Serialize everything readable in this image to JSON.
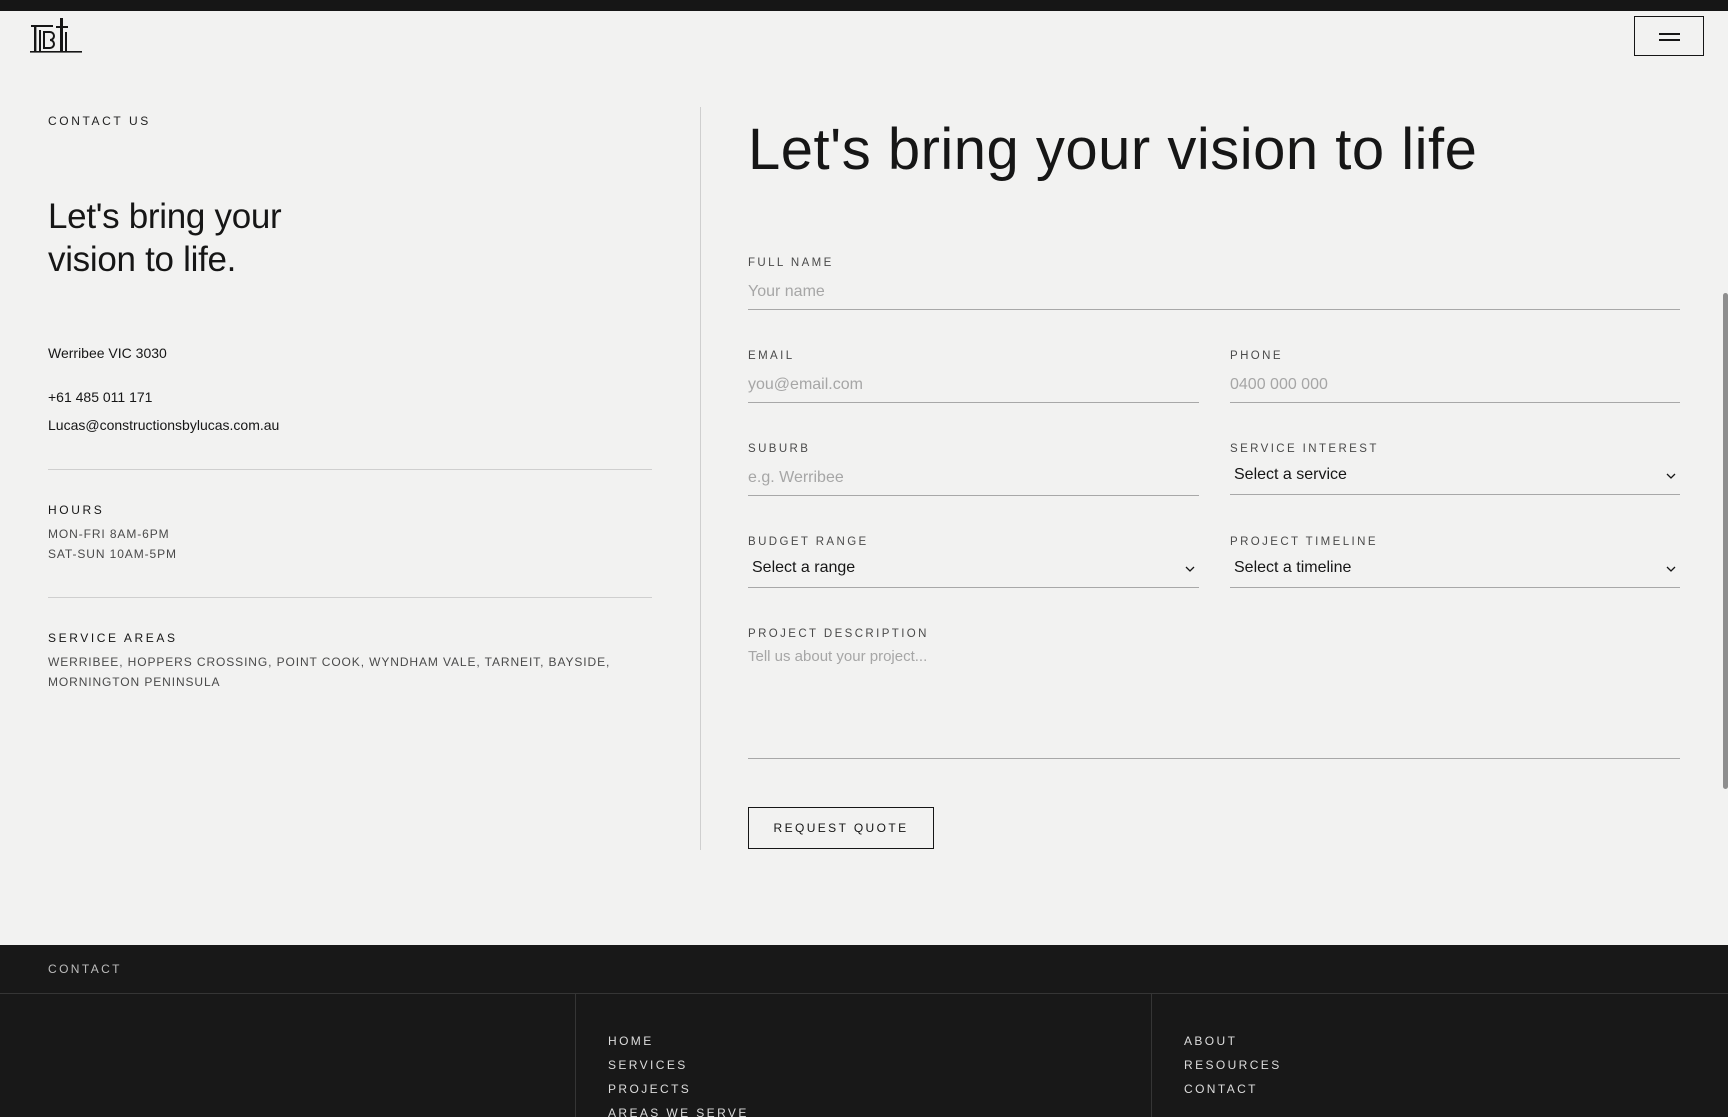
{
  "header": {
    "logo_alt": "TBL",
    "menu_icon": "hamburger-icon"
  },
  "contact": {
    "eyebrow": "CONTACT US",
    "heading": "Let's bring your vision to life.",
    "address": "Werribee VIC 3030",
    "phone": "+61 485 011 171",
    "email": "Lucas@constructionsbylucas.com.au",
    "hours_title": "HOURS",
    "hours": [
      "MON-FRI 8AM-6PM",
      "SAT-SUN 10AM-5PM"
    ],
    "areas_title": "SERVICE AREAS",
    "areas": "WERRIBEE, HOPPERS CROSSING, POINT COOK, WYNDHAM VALE, TARNEIT, BAYSIDE, MORNINGTON PENINSULA"
  },
  "form": {
    "heading": "Let's bring your vision to life",
    "full_name": {
      "label": "FULL NAME",
      "placeholder": "Your name"
    },
    "email": {
      "label": "EMAIL",
      "placeholder": "you@email.com"
    },
    "phone": {
      "label": "PHONE",
      "placeholder": "0400 000 000"
    },
    "suburb": {
      "label": "SUBURB",
      "placeholder": "e.g. Werribee"
    },
    "service": {
      "label": "SERVICE INTEREST",
      "value": "Select a service"
    },
    "budget": {
      "label": "BUDGET RANGE",
      "value": "Select a range"
    },
    "timeline": {
      "label": "PROJECT TIMELINE",
      "value": "Select a timeline"
    },
    "description": {
      "label": "PROJECT DESCRIPTION",
      "placeholder": "Tell us about your project..."
    },
    "submit_label": "REQUEST QUOTE"
  },
  "footer": {
    "label": "CONTACT",
    "nav_col1": [
      "HOME",
      "SERVICES",
      "PROJECTS",
      "AREAS WE SERVE"
    ],
    "nav_col2": [
      "ABOUT",
      "RESOURCES",
      "CONTACT"
    ]
  },
  "colors": {
    "background": "#f2f2f1",
    "text": "#161616",
    "footer_bg": "#181818"
  }
}
